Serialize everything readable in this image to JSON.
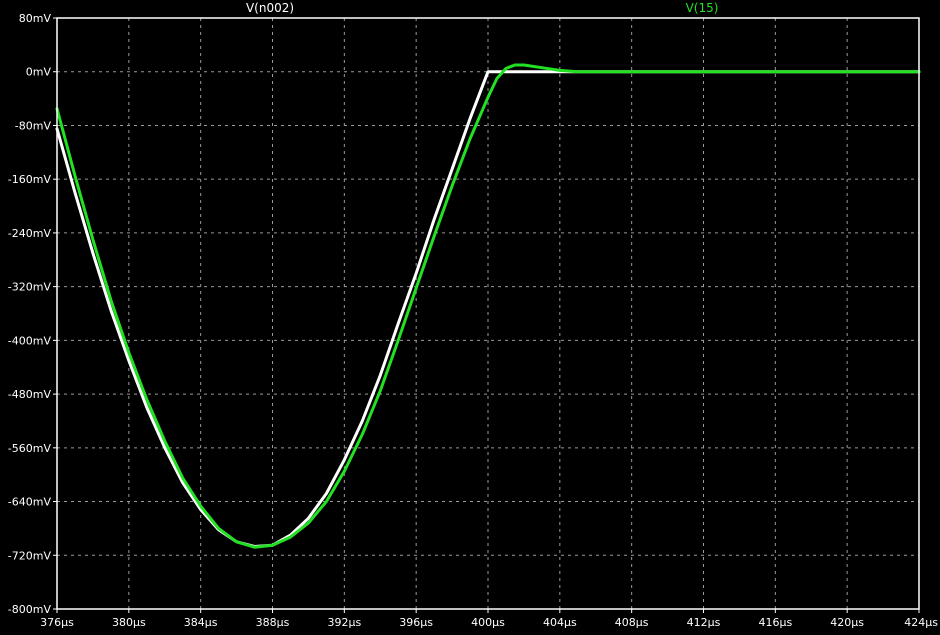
{
  "chart_data": {
    "type": "line",
    "background": "#000000",
    "grid": true,
    "grid_style": "dashed",
    "grid_color": "#9a9a9a",
    "frame_color": "#ffffff",
    "xlim": [
      376,
      424
    ],
    "ylim": [
      -800,
      80
    ],
    "x_unit": "µs",
    "y_unit": "mV",
    "x_ticks": [
      376,
      380,
      384,
      388,
      392,
      396,
      400,
      404,
      408,
      412,
      416,
      420,
      424
    ],
    "x_tick_labels": [
      "376µs",
      "380µs",
      "384µs",
      "388µs",
      "392µs",
      "396µs",
      "400µs",
      "404µs",
      "408µs",
      "412µs",
      "416µs",
      "420µs",
      "424µs"
    ],
    "y_ticks": [
      80,
      0,
      -80,
      -160,
      -240,
      -320,
      -400,
      -480,
      -560,
      -640,
      -720,
      -800
    ],
    "y_tick_labels": [
      "80mV",
      "0mV",
      "-80mV",
      "-160mV",
      "-240mV",
      "-320mV",
      "-400mV",
      "-480mV",
      "-560mV",
      "-640mV",
      "-720mV",
      "-800mV"
    ],
    "series": [
      {
        "name": "V(n002)",
        "color": "#ffffff",
        "x": [
          376,
          377,
          378,
          379,
          380,
          381,
          382,
          383,
          384,
          385,
          386,
          387,
          388,
          389,
          390,
          391,
          392,
          393,
          394,
          395,
          396,
          397,
          398,
          399,
          400,
          401,
          402,
          404,
          408,
          412,
          416,
          420,
          424
        ],
        "y": [
          -85,
          -180,
          -270,
          -355,
          -430,
          -500,
          -560,
          -612,
          -652,
          -682,
          -700,
          -707,
          -705,
          -690,
          -665,
          -628,
          -578,
          -520,
          -452,
          -375,
          -300,
          -220,
          -145,
          -70,
          0,
          0,
          0,
          0,
          0,
          0,
          0,
          0,
          0
        ]
      },
      {
        "name": "V(15)",
        "color": "#22e022",
        "x": [
          376,
          377,
          378,
          379,
          380,
          381,
          382,
          383,
          384,
          385,
          386,
          387,
          388,
          389,
          390,
          391,
          392,
          393,
          394,
          395,
          396,
          397,
          398,
          399,
          400,
          400.5,
          401,
          401.5,
          402,
          403,
          404,
          405,
          406,
          408,
          412,
          416,
          420,
          424
        ],
        "y": [
          -55,
          -155,
          -250,
          -340,
          -418,
          -488,
          -550,
          -605,
          -647,
          -680,
          -700,
          -708,
          -705,
          -693,
          -672,
          -640,
          -595,
          -540,
          -475,
          -400,
          -322,
          -245,
          -170,
          -100,
          -38,
          -10,
          5,
          10,
          10,
          6,
          2,
          0,
          0,
          0,
          0,
          0,
          0,
          0
        ]
      }
    ]
  }
}
